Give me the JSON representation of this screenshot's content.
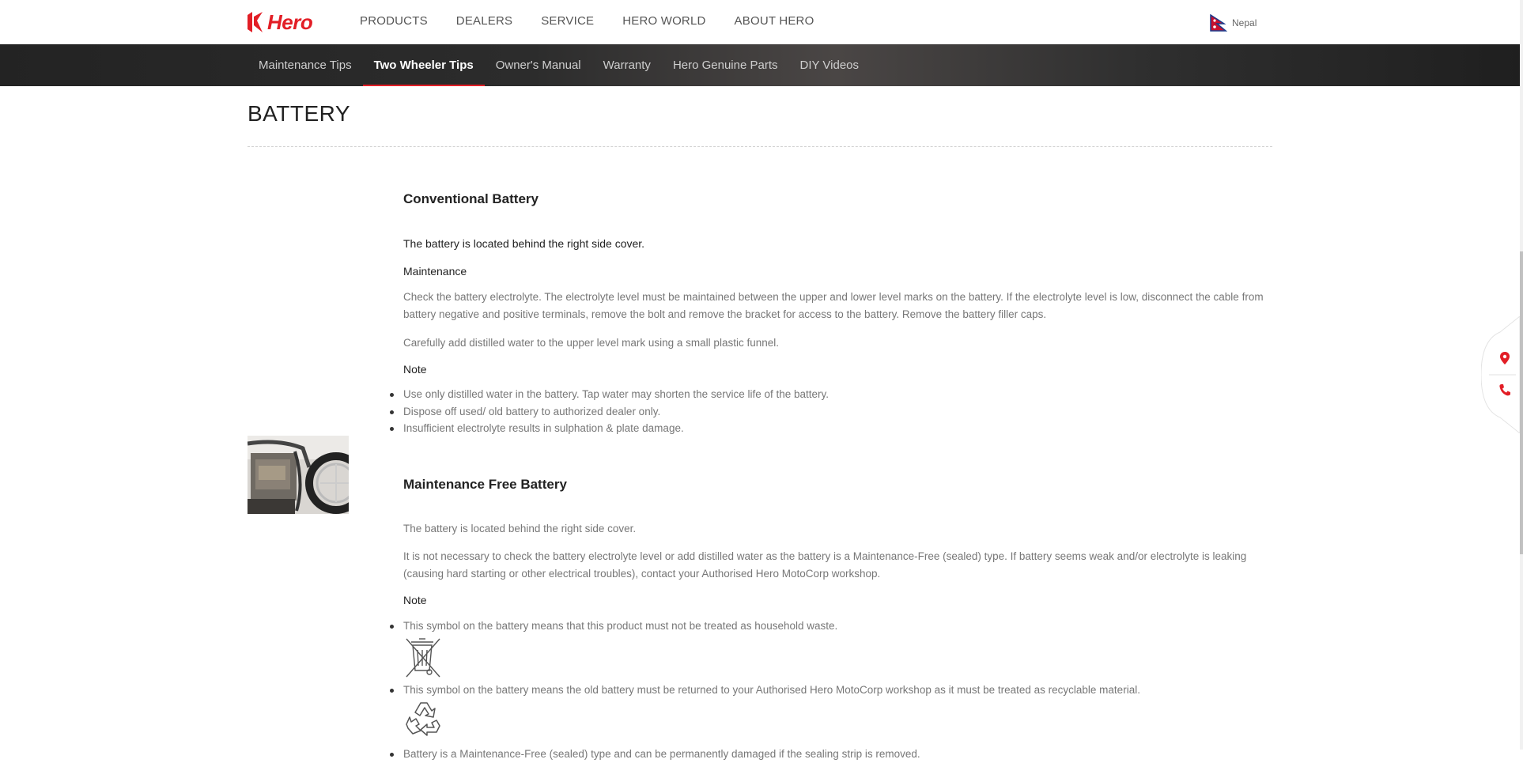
{
  "header": {
    "logo_text": "Hero",
    "nav": [
      "PRODUCTS",
      "DEALERS",
      "SERVICE",
      "HERO WORLD",
      "ABOUT HERO"
    ],
    "country": "Nepal"
  },
  "subnav": {
    "items": [
      "Maintenance Tips",
      "Two Wheeler Tips",
      "Owner's Manual",
      "Warranty",
      "Hero Genuine Parts",
      "DIY Videos"
    ],
    "active": "Two Wheeler Tips"
  },
  "page": {
    "title": "BATTERY"
  },
  "conventional": {
    "heading": "Conventional Battery",
    "location": "The battery is located behind the right side cover.",
    "maintenance_label": "Maintenance",
    "para1": "Check the battery electrolyte. The electrolyte level must be maintained between the upper and lower level marks on the battery. If the electrolyte level is low, disconnect the cable from battery negative and positive terminals, remove the bolt and remove the bracket for access to the battery. Remove the battery filler caps.",
    "para2": "Carefully add distilled water to the upper level mark using a small plastic funnel.",
    "note_label": "Note",
    "notes": [
      "Use only distilled water in the battery. Tap water may shorten the service life of the battery.",
      "Dispose off used/ old battery to authorized dealer only.",
      "Insufficient electrolyte results in sulphation & plate damage."
    ]
  },
  "mf": {
    "heading": "Maintenance Free Battery",
    "location": "The battery is located behind the right side cover.",
    "para1": "It is not necessary to check the battery electrolyte level or add distilled water as the battery is a Maintenance-Free (sealed) type. If battery seems weak and/or electrolyte is leaking (causing hard starting or other electrical troubles), contact your Authorised Hero MotoCorp workshop.",
    "note_label": "Note",
    "notes": [
      "This symbol on the battery means that this product must not be treated as household waste.",
      "This symbol on the battery means the old battery must be returned to your Authorised Hero MotoCorp workshop as it must be treated as recyclable material.",
      "Battery is a Maintenance-Free (sealed) type and can be permanently damaged if the sealing strip is removed."
    ]
  },
  "icons": {
    "logo": "hero-logo-icon",
    "flag": "nepal-flag-icon",
    "waste": "crossed-bin-icon",
    "recycle": "recycle-icon",
    "locate": "location-pin-icon",
    "call": "phone-icon"
  },
  "colors": {
    "brand_red": "#e21e26",
    "subnav_bg": "#2c2c2c"
  }
}
